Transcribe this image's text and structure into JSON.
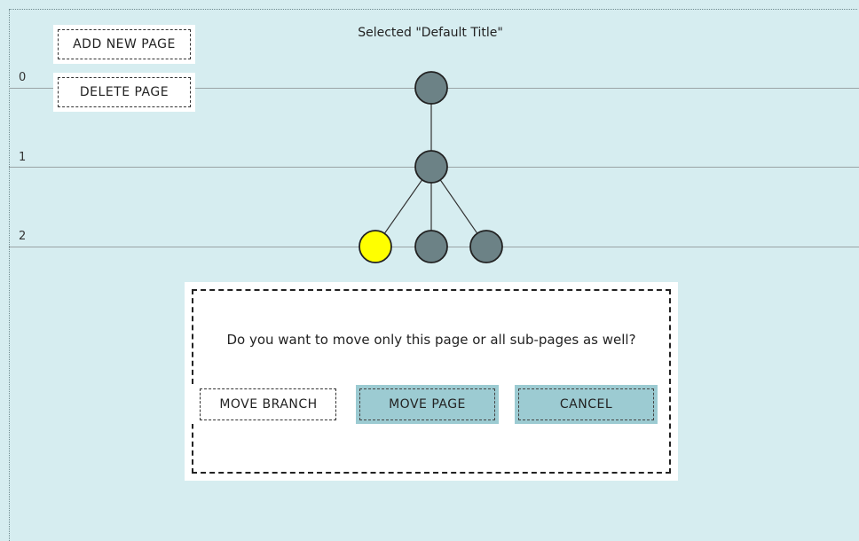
{
  "toolbar": {
    "add_page_label": "ADD NEW PAGE",
    "delete_page_label": "DELETE PAGE"
  },
  "selected": {
    "text": "Selected \"Default Title\""
  },
  "levels": [
    "0",
    "1",
    "2"
  ],
  "tree": {
    "node_color": "#6c8286",
    "selected_color": "#ffff00"
  },
  "dialog": {
    "message": "Do you want to move only this page or all sub-pages as well?",
    "move_branch_label": "MOVE BRANCH",
    "move_page_label": "MOVE PAGE",
    "cancel_label": "CANCEL"
  },
  "colors": {
    "background": "#d6edf0",
    "button_accent": "#9ccbd2"
  }
}
